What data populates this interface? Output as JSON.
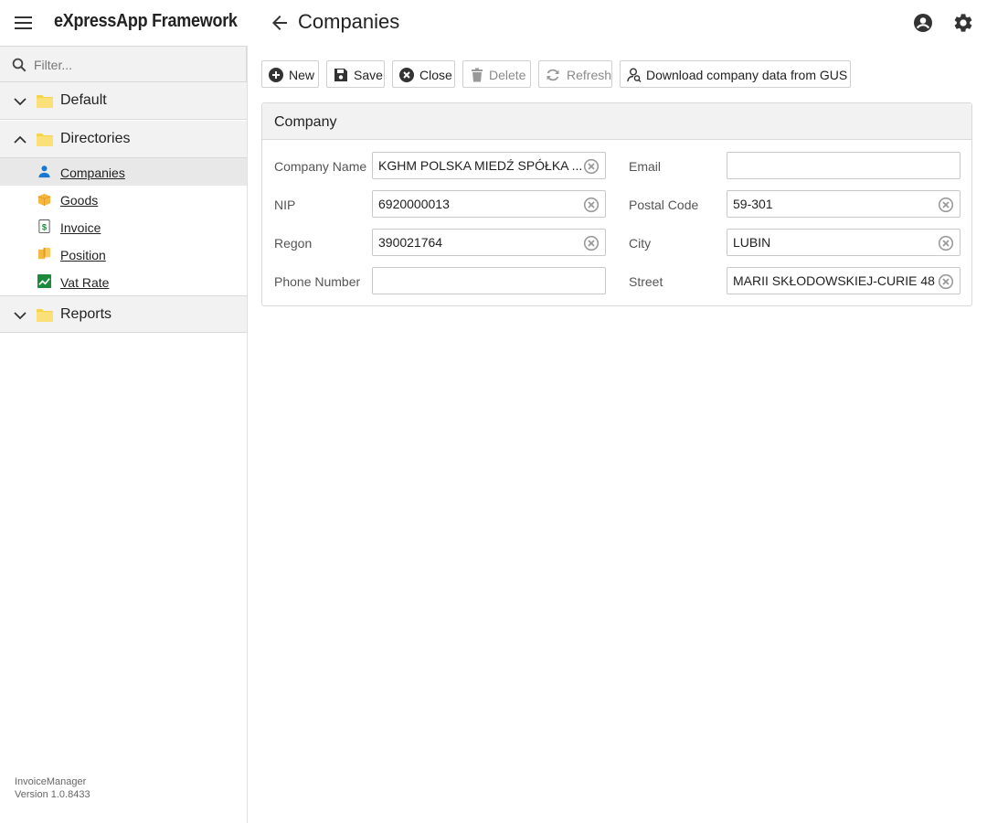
{
  "app": {
    "title": "eXpressApp Framework"
  },
  "view": {
    "title": "Companies"
  },
  "sidebar": {
    "filter_placeholder": "Filter...",
    "groups": [
      {
        "label": "Default",
        "expanded": false
      },
      {
        "label": "Directories",
        "expanded": true
      },
      {
        "label": "Reports",
        "expanded": false
      }
    ],
    "items": [
      {
        "label": "Companies",
        "icon": "person-icon",
        "active": true
      },
      {
        "label": "Goods",
        "icon": "goods-box-icon"
      },
      {
        "label": "Invoice",
        "icon": "invoice-dollar-icon"
      },
      {
        "label": "Position",
        "icon": "position-box-icon"
      },
      {
        "label": "Vat Rate",
        "icon": "chart-icon"
      }
    ],
    "footer": {
      "app_name": "InvoiceManager",
      "version": "Version 1.0.8433"
    }
  },
  "toolbar": {
    "new": "New",
    "save": "Save",
    "close": "Close",
    "delete": "Delete",
    "refresh": "Refresh",
    "download": "Download company data from GUS"
  },
  "panel": {
    "title": "Company",
    "fields": {
      "company_name": {
        "label": "Company Name",
        "value": "KGHM POLSKA MIEDŹ SPÓŁKA ..."
      },
      "nip": {
        "label": "NIP",
        "value": "6920000013"
      },
      "regon": {
        "label": "Regon",
        "value": "390021764"
      },
      "phone": {
        "label": "Phone Number",
        "value": ""
      },
      "email": {
        "label": "Email",
        "value": ""
      },
      "postal_code": {
        "label": "Postal Code",
        "value": "59-301"
      },
      "city": {
        "label": "City",
        "value": "LUBIN"
      },
      "street": {
        "label": "Street",
        "value": "MARII SKŁODOWSKIEJ-CURIE 48"
      }
    }
  },
  "colors": {
    "accent_blue": "#1976d2",
    "folder_yellow": "#f7d34a",
    "box_orange": "#f5b740",
    "chart_green": "#1b8a3a"
  }
}
